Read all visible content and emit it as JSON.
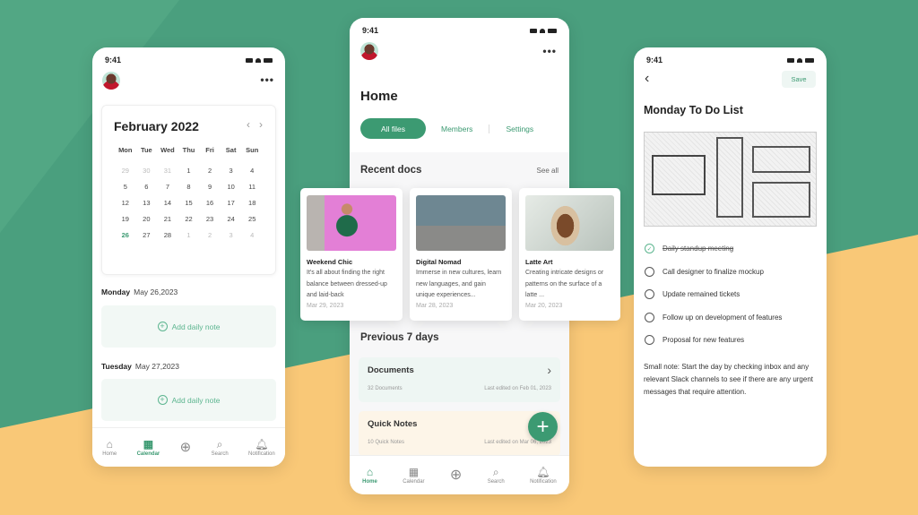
{
  "colors": {
    "green_bg": "#4a9f7e",
    "yellow_bg": "#f9c877",
    "accent": "#3c9a72"
  },
  "status_time": "9:41",
  "calendar_screen": {
    "month": "February 2022",
    "weekdays": [
      "Mon",
      "Tue",
      "Wed",
      "Thu",
      "Fri",
      "Sat",
      "Sun"
    ],
    "days": [
      [
        "29",
        "30",
        "31",
        "1",
        "2",
        "3",
        "4"
      ],
      [
        "5",
        "6",
        "7",
        "8",
        "9",
        "10",
        "11"
      ],
      [
        "12",
        "13",
        "14",
        "15",
        "16",
        "17",
        "18"
      ],
      [
        "19",
        "20",
        "21",
        "22",
        "23",
        "24",
        "25"
      ],
      [
        "26",
        "27",
        "28",
        "1",
        "2",
        "3",
        "4"
      ]
    ],
    "notes": [
      {
        "day": "Monday",
        "date": "May 26,2023",
        "action": "Add daily note"
      },
      {
        "day": "Tuesday",
        "date": "May 27,2023",
        "action": "Add daily note"
      }
    ],
    "tabs": [
      "Home",
      "Calendar",
      "",
      "Search",
      "Notification"
    ],
    "active_tab": "Calendar"
  },
  "home_screen": {
    "title": "Home",
    "filters": [
      "All files",
      "Members",
      "Settings"
    ],
    "recent_title": "Recent docs",
    "see_all": "See all",
    "cards": [
      {
        "title": "Weekend Chic",
        "text": "It's all about finding the right balance between dressed-up and laid-back",
        "date": "Mar 29, 2023"
      },
      {
        "title": "Digital Nomad",
        "text": "Immerse in new cultures, learn new languages, and gain unique experiences...",
        "date": "Mar 28, 2023"
      },
      {
        "title": "Latte Art",
        "text": "Creating intricate designs or patterns on the surface of a latte ...",
        "date": "Mar 20, 2023"
      }
    ],
    "previous_title": "Previous 7 days",
    "sections": [
      {
        "title": "Documents",
        "count": "32 Documents",
        "edited": "Last edited on Feb 01, 2023"
      },
      {
        "title": "Quick Notes",
        "count": "10 Quick Notes",
        "edited": "Last edited on Mar 06, 2023"
      }
    ],
    "tabs": [
      "Home",
      "Calendar",
      "",
      "Search",
      "Notification"
    ],
    "active_tab": "Home"
  },
  "todo_screen": {
    "save": "Save",
    "title": "Monday To Do List",
    "items": [
      {
        "text": "Daily standup meeting",
        "done": true
      },
      {
        "text": "Call designer to finalize mockup",
        "done": false
      },
      {
        "text": "Update remained tickets",
        "done": false
      },
      {
        "text": "Follow up on development of features",
        "done": false
      },
      {
        "text": "Proposal for new features",
        "done": false
      }
    ],
    "note": "Small note: Start the day by checking  inbox and any relevant Slack channels to see if there are any urgent messages that require attention."
  }
}
